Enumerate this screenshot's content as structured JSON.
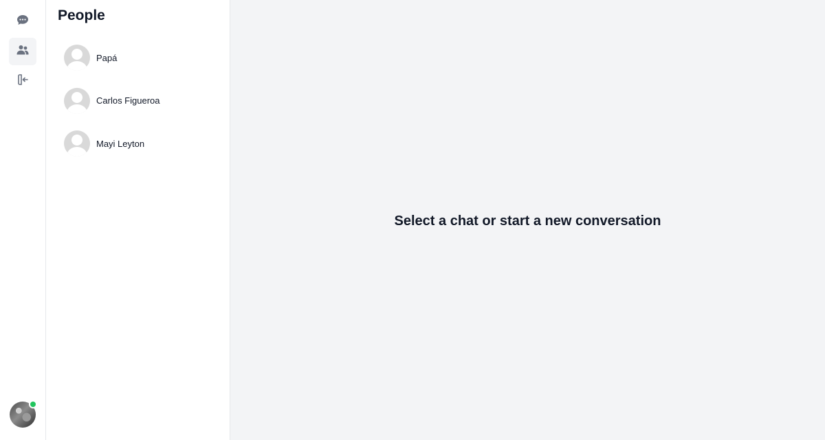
{
  "sidebar": {
    "nav": [
      {
        "name": "chats",
        "icon": "chat-bubble-icon"
      },
      {
        "name": "people",
        "icon": "users-icon",
        "active": true
      },
      {
        "name": "logout",
        "icon": "logout-icon"
      }
    ],
    "status_color": "#22c55e"
  },
  "people": {
    "title": "People",
    "items": [
      {
        "name": "Papá"
      },
      {
        "name": "Carlos Figueroa"
      },
      {
        "name": "Mayi Leyton"
      }
    ]
  },
  "main": {
    "empty_message": "Select a chat or start a new conversation"
  }
}
